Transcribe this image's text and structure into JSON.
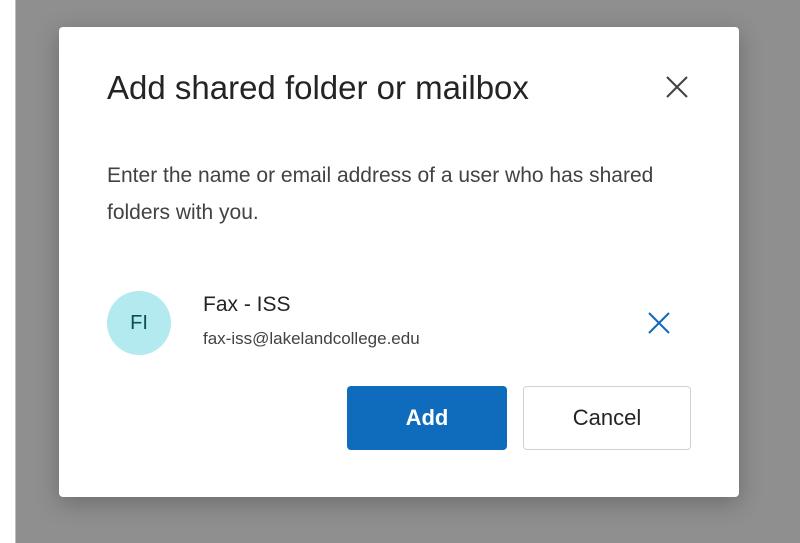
{
  "dialog": {
    "title": "Add shared folder or mailbox",
    "description": "Enter the name or email address of a user who has shared folders with you.",
    "close_icon": "close-icon",
    "selected_user": {
      "initials": "FI",
      "name": "Fax - ISS",
      "email": "fax-iss@lakelandcollege.edu",
      "avatar_color": "#b3eaef",
      "remove_icon": "remove-icon"
    },
    "buttons": {
      "add_label": "Add",
      "cancel_label": "Cancel"
    }
  },
  "colors": {
    "accent": "#0f6cbd",
    "overlay": "#8f8f8f"
  }
}
